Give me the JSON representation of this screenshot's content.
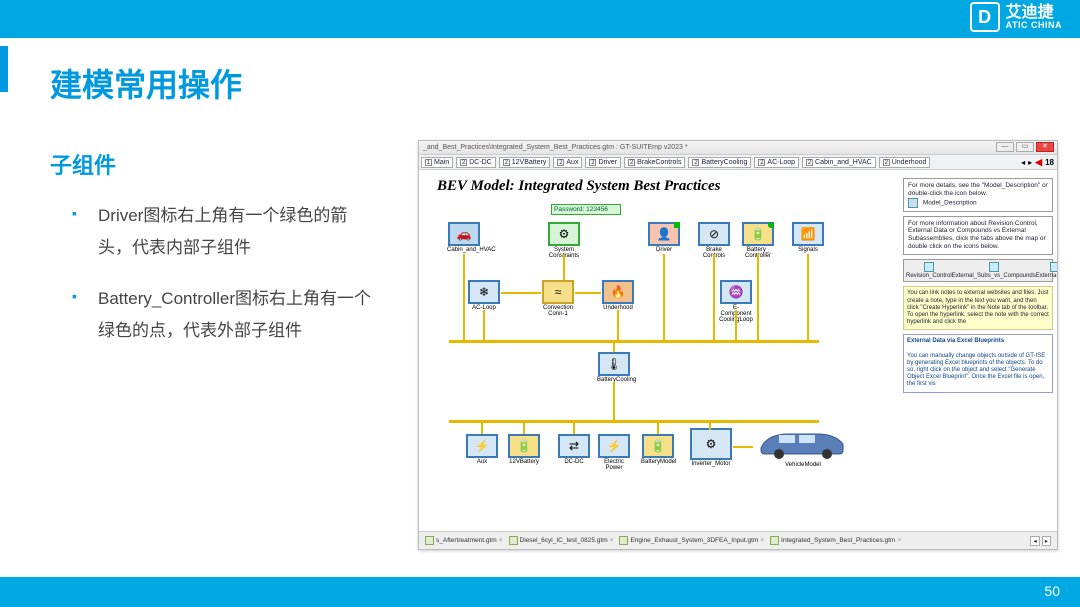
{
  "header": {
    "brand_cn": "艾迪捷",
    "brand_en": "ATIC CHINA",
    "mark": "D"
  },
  "title": "建模常用操作",
  "subtitle": "子组件",
  "bullets": [
    "Driver图标右上角有一个绿色的箭头，代表内部子组件",
    "Battery_Controller图标右上角有一个绿色的点，代表外部子组件"
  ],
  "page_number": "50",
  "shot": {
    "path": "_and_Best_Practices\\Integrated_System_Best_Practices.gtm : GT-SUITEmp v2023 *",
    "win_min": "—",
    "win_max": "▭",
    "win_close": "✕",
    "tabs": [
      {
        "n": "1",
        "t": "Main"
      },
      {
        "n": "2",
        "t": "DC-DC"
      },
      {
        "n": "2",
        "t": "12VBattery"
      },
      {
        "n": "2",
        "t": "Aux"
      },
      {
        "n": "2",
        "t": "Driver"
      },
      {
        "n": "2",
        "t": "BrakeControls"
      },
      {
        "n": "2",
        "t": "BatteryCooling"
      },
      {
        "n": "2",
        "t": "AC-Loop"
      },
      {
        "n": "2",
        "t": "Cabin_and_HVAC"
      },
      {
        "n": "2",
        "t": "Underhood"
      }
    ],
    "tab_end_count": "18",
    "canvas_title": "BEV Model: Integrated System Best Practices",
    "password_label": "Password: 123456",
    "info1": "For more details, see the \"Model_Description\" or double-click the icon below.",
    "info1_icon_label": "Model_Description",
    "info2": "For more information about Revision Control, External Data or Compounds vs External Subassemblies, click the tabs above the map or double click on the icons below.",
    "rev_items": [
      "Revision_Control",
      "External_Subs_vs_Compounds",
      "External_Data"
    ],
    "yellow_note": "You can link notes to external websites and files. Just create a note, type in the text you want, and then click \"Create Hyperlink\" in the Note tab of the toolbar. To open the hyperlink, select the note with the correct hyperlink and click the",
    "blue_title": "External Data via Excel Blueprints",
    "blue_note": "You can manually change objects outside of GT-ISE by generating Excel blueprints of the objects. To do so, right click on the object and select \"Generate Object Excel Blueprint\".\n\nOnce the Excel file is open, the first vis",
    "blocks": {
      "cabin": "Cabin_and_HVAC",
      "sysc": "System\nConstraints",
      "driver": "Driver",
      "brakec": "Brake\nControls",
      "battc": "Battery_\nController",
      "signals": "Signals",
      "acloop": "AC-Loop",
      "conv": "Convection\nConn-1",
      "under": "Underhood",
      "ecomp": "E-Component\nCoolingLoop",
      "bcool": "BatteryCooling",
      "aux": "Aux",
      "b12v": "12VBattery",
      "dcdc": "DC-DC",
      "epower": "Electric\nPower",
      "bmodel": "BatteryModel",
      "inv": "Inverter_Motor",
      "vmodel": "VehicleModel"
    },
    "bottom_tabs": [
      "s_Aftertreatment.gtm",
      "Diesel_6cyl_IC_test_0825.gtm",
      "Engine_Exhaust_System_3DFEA_Input.gtm",
      "Integrated_System_Best_Practices.gtm"
    ]
  }
}
